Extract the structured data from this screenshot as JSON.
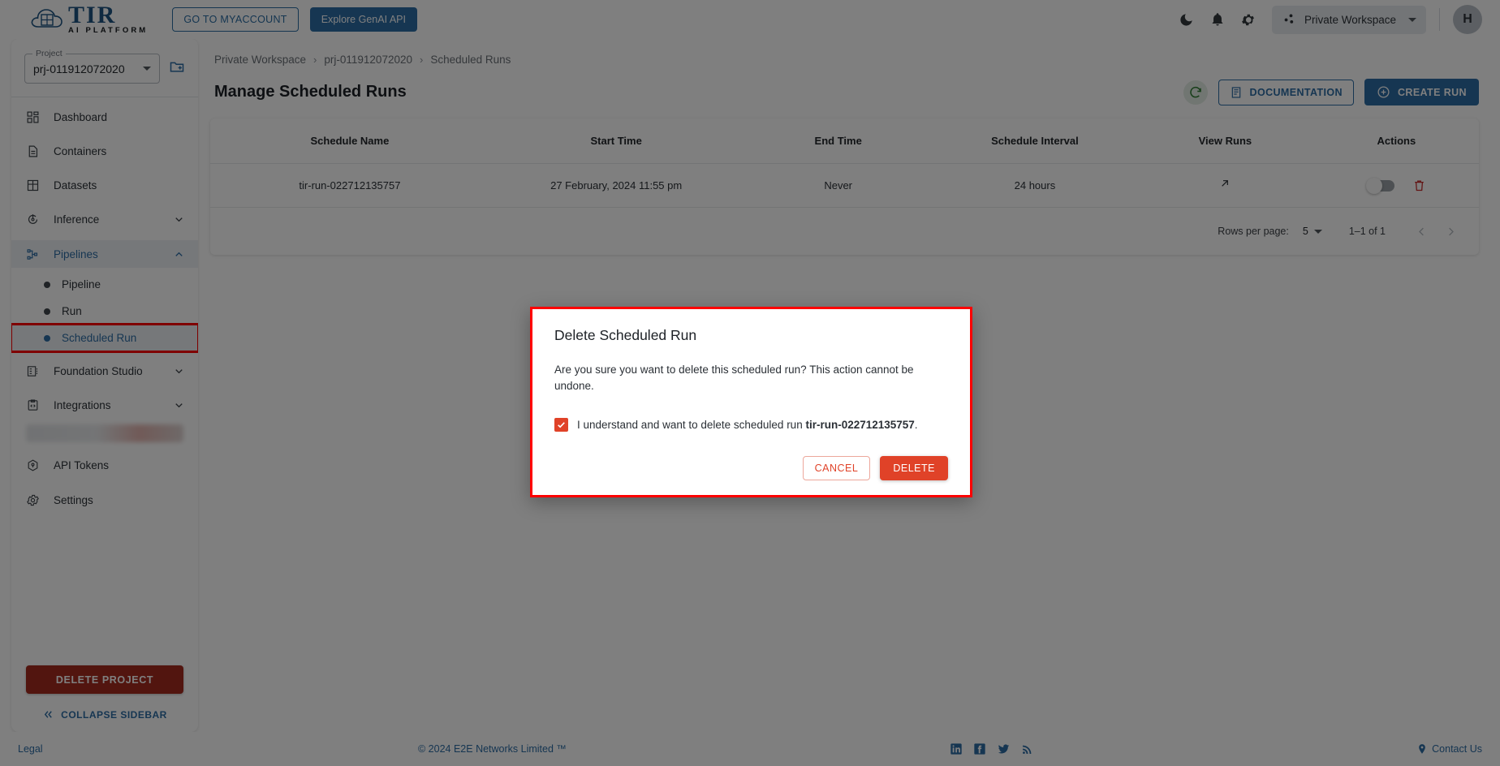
{
  "header": {
    "logo": {
      "title": "TIR",
      "subtitle": "AI PLATFORM",
      "cloud_icon": "cloud-icon"
    },
    "myaccount_button": "GO TO MYACCOUNT",
    "genai_button": "Explore GenAI API",
    "icons": [
      {
        "name": "dark-mode-icon",
        "glyph": "moon"
      },
      {
        "name": "notifications-icon",
        "glyph": "bell"
      },
      {
        "name": "settings-icon",
        "glyph": "gear"
      }
    ],
    "workspace": {
      "label": "Private Workspace",
      "icon": "workspace-icon"
    },
    "avatar": "H"
  },
  "sidebar": {
    "project": {
      "legend": "Project",
      "value": "prj-011912072020"
    },
    "folder_icon": "new-folder-icon",
    "items": [
      {
        "label": "Dashboard",
        "icon": "dashboard-icon",
        "expandable": false
      },
      {
        "label": "Containers",
        "icon": "containers-icon",
        "expandable": false
      },
      {
        "label": "Datasets",
        "icon": "datasets-icon",
        "expandable": false
      },
      {
        "label": "Inference",
        "icon": "inference-icon",
        "expandable": true,
        "expanded": false
      },
      {
        "label": "Pipelines",
        "icon": "pipelines-icon",
        "expandable": true,
        "expanded": true
      },
      {
        "label": "Foundation Studio",
        "icon": "foundation-studio-icon",
        "expandable": true,
        "expanded": false
      },
      {
        "label": "Integrations",
        "icon": "integrations-icon",
        "expandable": true,
        "expanded": false
      }
    ],
    "pipelines_children": [
      {
        "label": "Pipeline",
        "active": false
      },
      {
        "label": "Run",
        "active": false
      },
      {
        "label": "Scheduled Run",
        "active": true,
        "highlighted": true
      }
    ],
    "bottom_items": [
      {
        "label": "API Tokens",
        "icon": "api-tokens-icon"
      },
      {
        "label": "Settings",
        "icon": "settings-gear-icon"
      }
    ],
    "delete_project_button": "DELETE PROJECT",
    "collapse_label": "COLLAPSE SIDEBAR"
  },
  "breadcrumb": {
    "items": [
      "Private Workspace",
      "prj-011912072020",
      "Scheduled Runs"
    ],
    "separator": "›"
  },
  "page": {
    "title": "Manage Scheduled Runs",
    "refresh_icon": "refresh-icon",
    "documentation_button": "DOCUMENTATION",
    "create_run_button": "CREATE RUN"
  },
  "table": {
    "columns": [
      "Schedule Name",
      "Start Time",
      "End Time",
      "Schedule Interval",
      "View Runs",
      "Actions"
    ],
    "rows": [
      {
        "schedule_name": "tir-run-022712135757",
        "start_time": "27 February, 2024 11:55 pm",
        "end_time": "Never",
        "schedule_interval": "24 hours",
        "view_runs_icon": "external-link-arrow-icon",
        "toggle_on": false,
        "delete_icon": "trash-icon"
      }
    ]
  },
  "pagination": {
    "rows_per_page_label": "Rows per page:",
    "rows_per_page_value": "5",
    "range_label": "1–1 of 1",
    "prev_icon": "chevron-left-icon",
    "next_icon": "chevron-right-icon"
  },
  "modal": {
    "title": "Delete Scheduled Run",
    "body": "Are you sure you want to delete this scheduled run? This action cannot be undone.",
    "checkbox_checked": true,
    "confirm_text_prefix": "I understand and want to delete scheduled run ",
    "confirm_text_target": "tir-run-022712135757",
    "confirm_text_suffix": ".",
    "cancel_button": "CANCEL",
    "delete_button": "DELETE"
  },
  "footer": {
    "legal": "Legal",
    "copyright": "© 2024 E2E Networks Limited ™",
    "social": [
      {
        "name": "linkedin-icon"
      },
      {
        "name": "facebook-icon"
      },
      {
        "name": "twitter-icon"
      },
      {
        "name": "rss-icon"
      }
    ],
    "contact": "Contact Us"
  },
  "colors": {
    "brand_blue": "#2c6ca4",
    "danger_red": "#e04228",
    "delete_project_red": "#a52a1f",
    "highlight_red": "#ff0000",
    "refresh_green": "#2e7d32"
  }
}
